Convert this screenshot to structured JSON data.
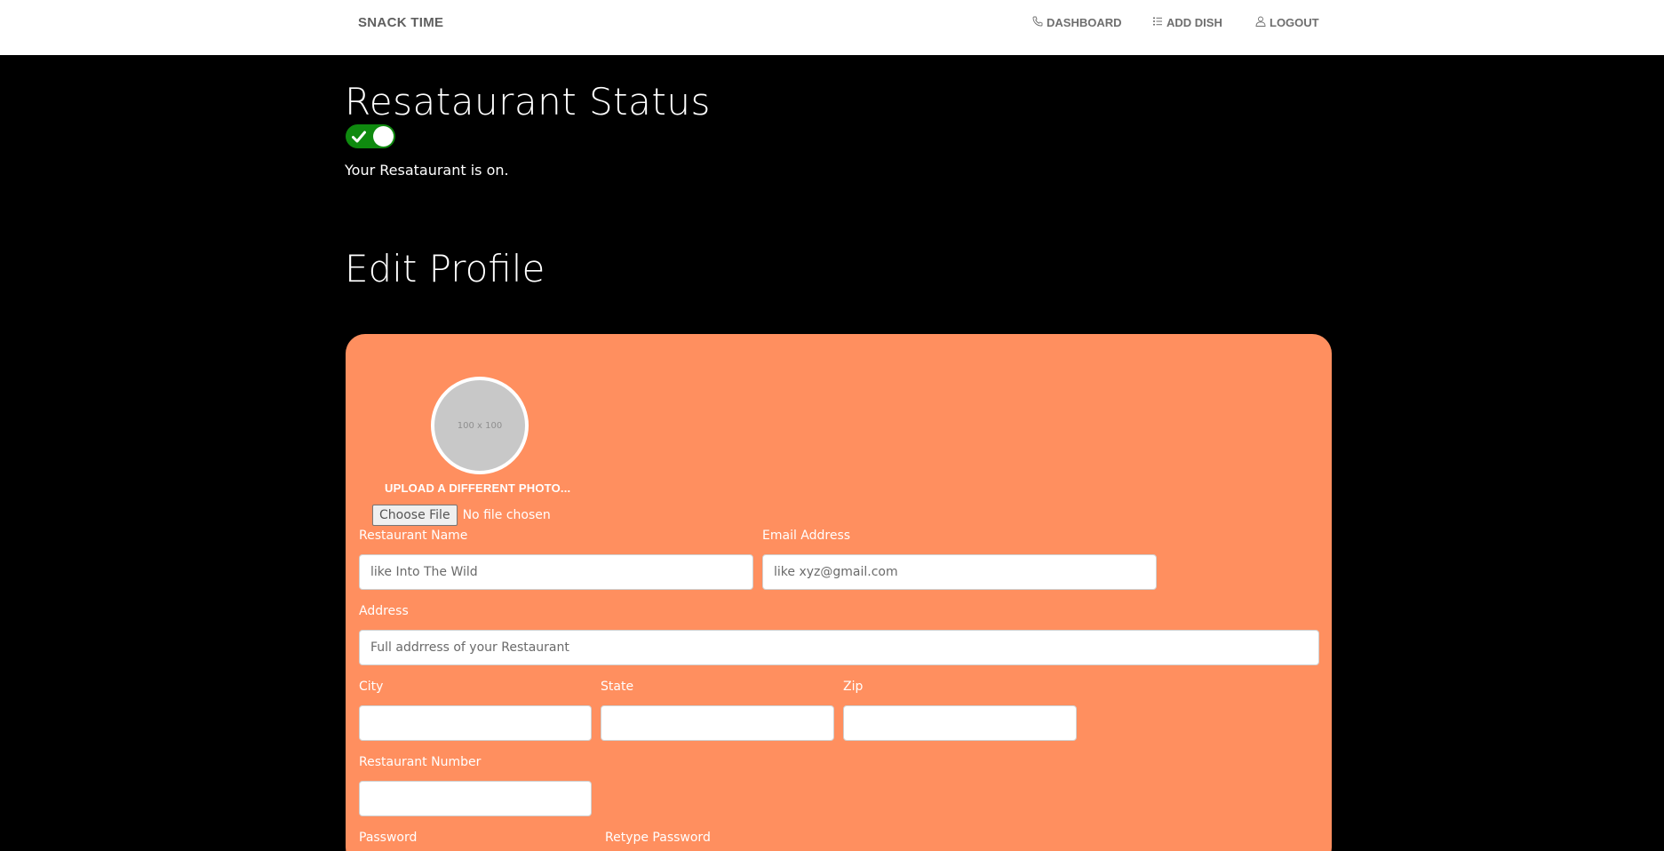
{
  "nav": {
    "brand": "SNACK TIME",
    "items": [
      {
        "label": "DASHBOARD",
        "icon": "phone-icon"
      },
      {
        "label": "ADD DISH",
        "icon": "list-icon"
      },
      {
        "label": "LOGOUT",
        "icon": "user-icon"
      }
    ]
  },
  "status": {
    "title": "Resataurant Status",
    "toggle_on": true,
    "toggle_color": "#0f8a0f",
    "message": "Your Resataurant is on."
  },
  "profile": {
    "title": "Edit Profile",
    "card_color": "#ff8f5f",
    "avatar_placeholder": "100 x 100",
    "upload_label": "UPLOAD A DIFFERENT PHOTO...",
    "choose_file": "Choose File",
    "file_status": "No file chosen",
    "fields": {
      "restaurant_name": {
        "label": "Restaurant Name",
        "placeholder": "like Into The Wild",
        "value": ""
      },
      "email": {
        "label": "Email Address",
        "placeholder": "like xyz@gmail.com",
        "value": ""
      },
      "address": {
        "label": "Address",
        "placeholder": "Full addrress of your Restaurant",
        "value": ""
      },
      "city": {
        "label": "City",
        "placeholder": "",
        "value": ""
      },
      "state": {
        "label": "State",
        "placeholder": "",
        "value": ""
      },
      "zip": {
        "label": "Zip",
        "placeholder": "",
        "value": ""
      },
      "restaurant_number": {
        "label": "Restaurant Number",
        "placeholder": "",
        "value": ""
      },
      "password": {
        "label": "Password"
      },
      "retype_password": {
        "label": "Retype Password"
      }
    }
  }
}
